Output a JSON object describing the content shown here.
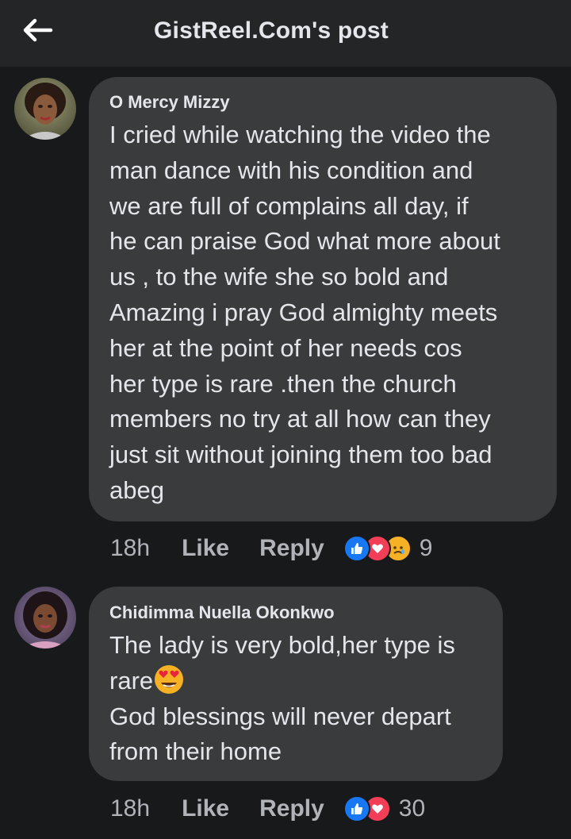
{
  "header": {
    "title": "GistReel.Com's post"
  },
  "comments": [
    {
      "author": "O Mercy Mizzy",
      "text": "I cried while watching the video the\nman dance with his condition and\nwe are full of complains all day,  if\nhe can praise God what more about\nus ,  to the wife she so bold and\nAmazing i pray God almighty meets\nher at the point of her needs cos\nher type is rare .then the church\nmembers no try at all how can they\njust sit without joining them too bad\nabeg",
      "time": "18h",
      "like_label": "Like",
      "reply_label": "Reply",
      "reaction_icons": [
        "like-icon",
        "love-icon",
        "sad-icon"
      ],
      "reaction_count": "9"
    },
    {
      "author": "Chidimma Nuella Okonkwo",
      "text_line1": "The lady is very bold,her type is",
      "text_line2": "rare",
      "text_emoji": "heart-eyes-emoji",
      "text_rest": "God blessings will never depart\nfrom their home",
      "time": "18h",
      "like_label": "Like",
      "reply_label": "Reply",
      "reaction_icons": [
        "like-icon",
        "love-icon"
      ],
      "reaction_count": "30"
    }
  ],
  "colors": {
    "background": "#18191a",
    "header": "#242526",
    "bubble": "#3a3b3c",
    "text": "#e4e6eb",
    "secondary_text": "#b0b3b8",
    "like_blue": "#1877f2",
    "love_red": "#f33e58",
    "sad_yellow": "#f7b125"
  }
}
